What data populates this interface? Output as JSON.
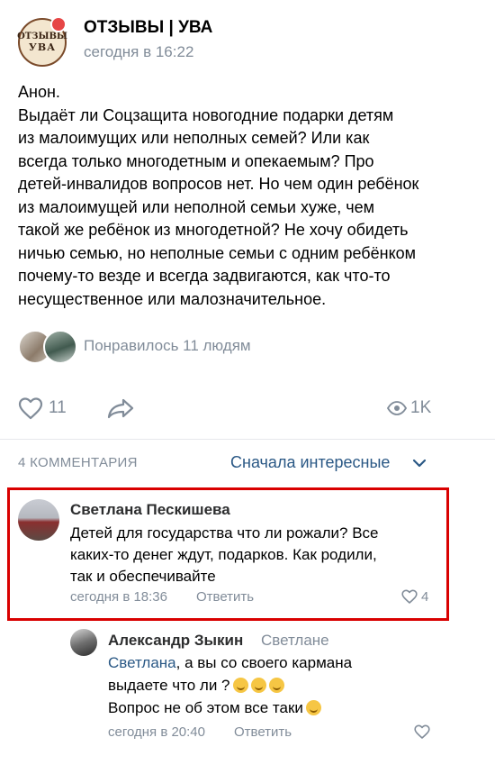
{
  "post": {
    "group_name": "ОТЗЫВЫ | УВА",
    "logo_text_top": "ОТЗЫВЫ",
    "logo_text_bottom": "УВА",
    "time": "сегодня в 16:22",
    "text": "Анон.\nВыдаёт ли Соцзащита новогодние подарки детям\nиз малоимущих или неполных семей? Или как\nвсегда только многодетным и опекаемым? Про\nдетей-инвалидов вопросов нет. Но чем один ребёнок\nиз малоимущей или неполной семьи хуже, чем\nтакой же ребёнок из многодетной? Не хочу обидеть\nничью семью, но неполные семьи с одним ребёнком\nпочему-то везде и всегда задвигаются, как что-то\nнесущественное или малозначительное.",
    "liked_by": "Понравилось 11 людям",
    "likes": "11",
    "views": "1K"
  },
  "comments_header": {
    "count_label": "4 КОММЕНТАРИЯ",
    "sort_label": "Сначала интересные"
  },
  "comment": {
    "author": "Светлана Пескишева",
    "text": "Детей для государства что ли рожали? Все\nкаких-то денег ждут, подарков. Как родили,\nтак и обеспечивайте",
    "time": "сегодня в 18:36",
    "reply_label": "Ответить",
    "likes": "4",
    "highlight_color": "#d90000"
  },
  "reply": {
    "author": "Александр Зыкин",
    "reply_to": "Светлане",
    "mention": "Светлана",
    "line1_rest": ", а вы со своего кармана",
    "line2": "выдаете что ли ?",
    "line3": "Вопрос не об этом все таки",
    "time": "сегодня в 20:40",
    "reply_label": "Ответить"
  },
  "colors": {
    "link": "#2a5885",
    "secondary": "#818c99",
    "badge": "#e64646"
  }
}
